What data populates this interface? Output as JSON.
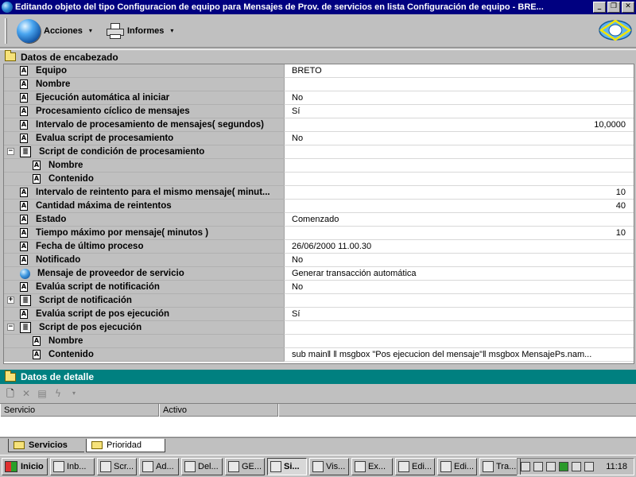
{
  "window": {
    "title": "Editando objeto del tipo Configuracion de equipo para Mensajes de Prov. de servicios en lista Configuración de equipo - BRE...",
    "min": "_",
    "restore": "❐",
    "close": "✕"
  },
  "toolbar": {
    "acciones": "Acciones",
    "informes": "Informes",
    "caret": "▾"
  },
  "header_section": {
    "title": "Datos de encabezado"
  },
  "properties": [
    {
      "label": "Equipo",
      "value": "BRETO",
      "icon": "field-icon",
      "level": 0
    },
    {
      "label": "Nombre",
      "value": "",
      "icon": "field-icon",
      "level": 0
    },
    {
      "label": "Ejecución automática al iniciar",
      "value": "No",
      "icon": "field-icon",
      "level": 0
    },
    {
      "label": "Procesamiento cíclico de mensajes",
      "value": "Sí",
      "icon": "field-icon",
      "level": 0
    },
    {
      "label": "Intervalo de procesamiento de mensajes( segundos)",
      "value": "10,0000",
      "icon": "field-icon",
      "level": 0,
      "numeric": true
    },
    {
      "label": "Evalua script de procesamiento",
      "value": "No",
      "icon": "field-icon",
      "level": 0
    },
    {
      "label": "Script de condición de procesamiento",
      "value": "",
      "icon": "script-icon",
      "level": 0,
      "expander": "−"
    },
    {
      "label": "Nombre",
      "value": "",
      "icon": "field-icon",
      "level": 1
    },
    {
      "label": "Contenido",
      "value": "",
      "icon": "field-icon",
      "level": 1
    },
    {
      "label": "Intervalo de reintento para el mismo mensaje( minut...",
      "value": "10",
      "icon": "field-icon",
      "level": 0,
      "numeric": true
    },
    {
      "label": "Cantidad máxima de reintentos",
      "value": "40",
      "icon": "field-icon",
      "level": 0,
      "numeric": true
    },
    {
      "label": "Estado",
      "value": "Comenzado",
      "icon": "field-icon",
      "level": 0
    },
    {
      "label": "Tiempo máximo por mensaje( minutos )",
      "value": "10",
      "icon": "field-icon",
      "level": 0,
      "numeric": true
    },
    {
      "label": "Fecha de último proceso",
      "value": "26/06/2000 11.00.30",
      "icon": "field-icon",
      "level": 0
    },
    {
      "label": "Notificado",
      "value": "No",
      "icon": "field-icon",
      "level": 0
    },
    {
      "label": "Mensaje de proveedor de servicio",
      "value": "Generar transacción automática",
      "icon": "globe-icon",
      "level": 0
    },
    {
      "label": "Evalúa script de notificación",
      "value": "No",
      "icon": "field-icon",
      "level": 0
    },
    {
      "label": "Script de notificación",
      "value": "",
      "icon": "script-icon",
      "level": 0,
      "expander": "+"
    },
    {
      "label": "Evalúa script de pos ejecución",
      "value": "Sí",
      "icon": "field-icon",
      "level": 0
    },
    {
      "label": "Script de pos ejecución",
      "value": "",
      "icon": "script-icon",
      "level": 0,
      "expander": "−"
    },
    {
      "label": "Nombre",
      "value": "",
      "icon": "field-icon",
      "level": 1
    },
    {
      "label": "Contenido",
      "value": "sub main‖ ‖  msgbox \"Pos ejecucion del mensaje\"‖  msgbox MensajePs.nam...",
      "icon": "field-icon",
      "level": 1
    }
  ],
  "detail_section": {
    "title": "Datos de detalle",
    "columns": [
      "Servicio",
      "Activo"
    ]
  },
  "tabs": [
    "Servicios",
    "Prioridad"
  ],
  "taskbar": {
    "start": "Inicio",
    "tasks": [
      "Inb...",
      "Scr...",
      "Ad...",
      "Del...",
      "GE...",
      "Si...",
      "Vis...",
      "Ex...",
      "Edi...",
      "Edi...",
      "Tra..."
    ],
    "active_index": 5,
    "clock": "11:18"
  }
}
